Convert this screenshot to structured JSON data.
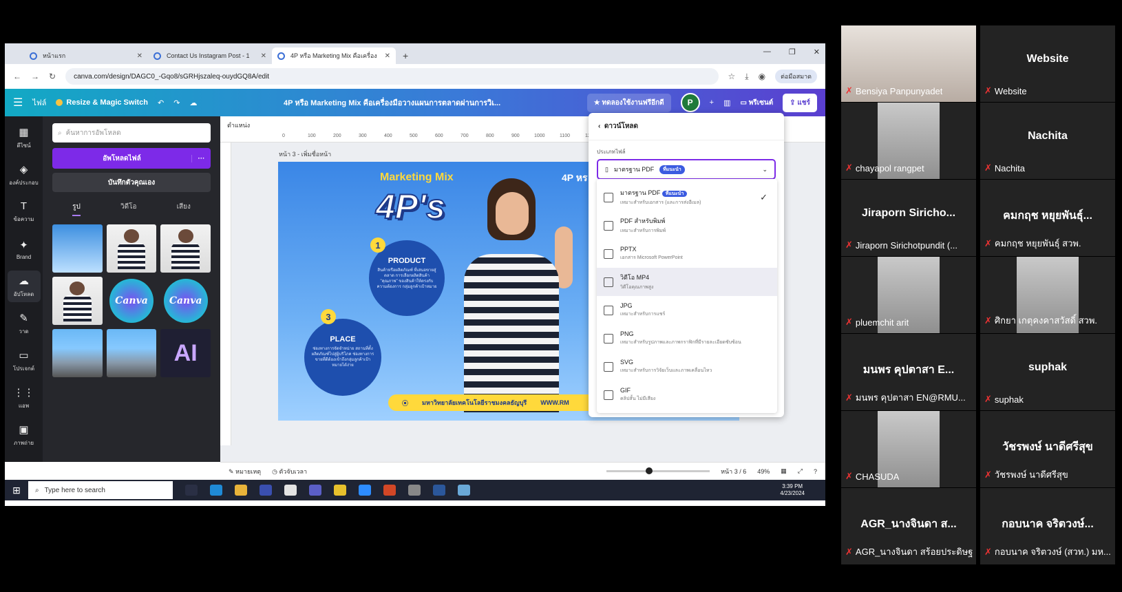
{
  "browser": {
    "tabs": [
      {
        "label": "หน้าแรก"
      },
      {
        "label": "Contact Us Instagram Post - 1"
      },
      {
        "label": "4P หรือ Marketing Mix คือเครื่อง"
      }
    ],
    "url": "canva.com/design/DAGC0_-Gqo8/sGRHjszaleq-ouydGQ8A/edit",
    "profile": "ต่อมือสมาด"
  },
  "canva_header": {
    "file": "ไฟล์",
    "magic": "Resize & Magic Switch",
    "title": "4P หรือ Marketing Mix คือเครื่องมือวางแผนการตลาดผ่านการวิเ...",
    "trial": "ทดลองใช้งานฟรีอีกดี",
    "avatar": "P",
    "present": "พรีเซนต์",
    "share": "แชร์"
  },
  "rail": [
    {
      "label": "ดีไซน์",
      "icon": "▦"
    },
    {
      "label": "องค์ประกอบ",
      "icon": "◈"
    },
    {
      "label": "ข้อความ",
      "icon": "T"
    },
    {
      "label": "Brand",
      "icon": "✦"
    },
    {
      "label": "อัปโหลด",
      "icon": "☁"
    },
    {
      "label": "วาด",
      "icon": "✎"
    },
    {
      "label": "โปรเจกต์",
      "icon": "▭"
    },
    {
      "label": "แอพ",
      "icon": "⋮⋮"
    },
    {
      "label": "ภาพถ่าย",
      "icon": "▣"
    }
  ],
  "panel": {
    "search_placeholder": "ค้นหาการอัพโหลด",
    "upload": "อัพโหลดไฟล์",
    "record": "บันทึกตัวคุณเอง",
    "tabs": [
      "รูป",
      "วิดีโอ",
      "เสียง"
    ]
  },
  "workspace": {
    "position": "ตำแหน่ง",
    "ruler": [
      "0",
      "100",
      "200",
      "300",
      "400",
      "500",
      "600",
      "700",
      "800",
      "900",
      "1000",
      "1100",
      "1200"
    ],
    "page_label": "หน้า 3 - เพิ่มชื่อหน้า"
  },
  "design": {
    "marketing_mix": "Marketing Mix",
    "four_p": "4P's",
    "product_num": "1",
    "product": "PRODUCT",
    "product_desc": "สินค้าหรือผลิตภัณฑ์ ที่เสนอขายสู่ตลาด การเลือกผลิตสินค้า \"คุณภาพ\" ของสินค้าให้ตรงกับความต้องการ กลุ่มลูกค้าเป้าหมาย",
    "place_num": "3",
    "place": "PLACE",
    "place_desc": "ช่องทางการจัดจำหน่าย สถานที่ตั้งผลิตภัณฑ์ไปสู่ผู้บริโภค ช่องทางการขายที่ดีต้องเข้าถึงกลุ่มลูกค้าเป้าหมายได้ง่าย",
    "side_text": "4P หร เครื่อ ผ่าน การ",
    "footer_uni": "มหาวิทยาลัยเทคโนโลยีราชมงคลธัญบุรี",
    "footer_web": "WWW.RM"
  },
  "download": {
    "title": "ดาวน์โหลด",
    "file_type": "ประเภทไฟล์",
    "selected": "มาตรฐาน PDF",
    "selected_badge": "ที่แนะนำ",
    "options": [
      {
        "name": "มาตรฐาน PDF",
        "badge": "ที่แนะนำ",
        "desc": "เหมาะสำหรับเอกสาร (และการส่งอีเมล)",
        "icon": "pdf-icon",
        "checked": "✓"
      },
      {
        "name": "PDF สำหรับพิมพ์",
        "badge": "",
        "desc": "เหมาะสำหรับการพิมพ์",
        "icon": "pdf-print-icon",
        "checked": ""
      },
      {
        "name": "PPTX",
        "badge": "",
        "desc": "เอกสาร Microsoft PowerPoint",
        "icon": "pptx-icon",
        "checked": ""
      },
      {
        "name": "วิดีโอ MP4",
        "badge": "",
        "desc": "วิดีโอคุณภาพสูง",
        "icon": "video-icon",
        "checked": ""
      },
      {
        "name": "JPG",
        "badge": "",
        "desc": "เหมาะสำหรับการแชร์",
        "icon": "image-icon",
        "checked": ""
      },
      {
        "name": "PNG",
        "badge": "",
        "desc": "เหมาะสำหรับรูปภาพและภาพกราฟิกที่มีรายละเอียดซับซ้อน",
        "icon": "image-icon",
        "checked": ""
      },
      {
        "name": "SVG",
        "badge": "",
        "desc": "เหมาะสำหรับการวิจัยเว็บและภาพเคลื่อนไหว",
        "icon": "image-icon",
        "checked": ""
      },
      {
        "name": "GIF",
        "badge": "",
        "desc": "คลิปสั้น ไม่มีเสียง",
        "icon": "gif-icon",
        "checked": ""
      }
    ]
  },
  "footer": {
    "notes": "หมายเหตุ",
    "timer": "ตัวจับเวลา",
    "page": "หน้า 3 / 6",
    "zoom": "49%",
    "zoom_level": 0.38
  },
  "taskbar": {
    "search": "Type here to search",
    "time": "3:39 PM",
    "date": "4/23/2024"
  },
  "participants": [
    {
      "label": "Bensiya Panpunyadet",
      "display": "",
      "speaking": true
    },
    {
      "label": "Website",
      "display": "Website"
    },
    {
      "label": "chayapol rangpet",
      "display": ""
    },
    {
      "label": "Nachita",
      "display": "Nachita"
    },
    {
      "label": "Jiraporn Sirichotpundit (...",
      "display": "Jiraporn  Siricho..."
    },
    {
      "label": "คมกฤช หยุยพันธุ์ สวพ.",
      "display": "คมกฤช หยุยพันธุ์..."
    },
    {
      "label": "pluemchit arit",
      "display": ""
    },
    {
      "label": "ศิกยา เกตุคงคาสวัสดิ์ สวพ.",
      "display": ""
    },
    {
      "label": "มนพร คุปตาสา EN@RMU...",
      "display": "มนพร  คุปตาสา E..."
    },
    {
      "label": "suphak",
      "display": "suphak"
    },
    {
      "label": "CHASUDA",
      "display": ""
    },
    {
      "label": "วัชรพงษ์ นาดีศรีสุข",
      "display": "วัชรพงษ์ นาดีศรีสุข"
    },
    {
      "label": "AGR_นางจินดา สร้อยประดิษฐ",
      "display": "AGR_นางจินดา ส..."
    },
    {
      "label": "กอบนาค จริตวงษ์ (สวท.) มห...",
      "display": "กอบนาค จริตวงษ์..."
    }
  ]
}
